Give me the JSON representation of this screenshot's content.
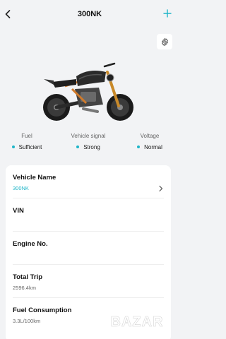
{
  "header": {
    "title": "300NK"
  },
  "status": [
    {
      "label": "Fuel",
      "value": "Sufficient"
    },
    {
      "label": "Vehicle signal",
      "value": "Strong"
    },
    {
      "label": "Voltage",
      "value": "Normal"
    }
  ],
  "details": {
    "vehicle_name_label": "Vehicle Name",
    "vehicle_name_value": "300NK",
    "vin_label": "VIN",
    "engine_label": "Engine No.",
    "total_trip_label": "Total Trip",
    "total_trip_value": "2596.4km",
    "fuel_consumption_label": "Fuel Consumption",
    "fuel_consumption_value": "3.3L/100km"
  },
  "watermark": {
    "text": "BAZAR"
  },
  "colors": {
    "accent": "#1fb5c8",
    "background": "#f2f3f5",
    "card": "#ffffff"
  }
}
